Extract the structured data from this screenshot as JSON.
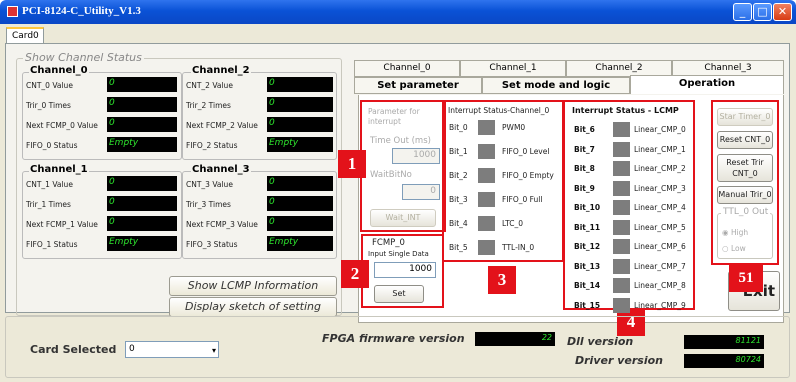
{
  "window": {
    "title": "PCI-8124-C_Utility_V1.3",
    "tab": "Card0"
  },
  "show_channel_status": {
    "title": "Show Channel Status",
    "channels": [
      {
        "name": "Channel_0",
        "rows": [
          {
            "label": "CNT_0 Value",
            "value": "0"
          },
          {
            "label": "Trir_0 Times",
            "value": "0"
          },
          {
            "label": "Next FCMP_0 Value",
            "value": "0"
          },
          {
            "label": "FIFO_0 Status",
            "value": "Empty"
          }
        ]
      },
      {
        "name": "Channel_2",
        "rows": [
          {
            "label": "CNT_2 Value",
            "value": "0"
          },
          {
            "label": "Trir_2 Times",
            "value": "0"
          },
          {
            "label": "Next FCMP_2 Value",
            "value": "0"
          },
          {
            "label": "FIFO_2 Status",
            "value": "Empty"
          }
        ]
      },
      {
        "name": "Channel_1",
        "rows": [
          {
            "label": "CNT_1 Value",
            "value": "0"
          },
          {
            "label": "Trir_1 Times",
            "value": "0"
          },
          {
            "label": "Next FCMP_1 Value",
            "value": "0"
          },
          {
            "label": "FIFO_1 Status",
            "value": "Empty"
          }
        ]
      },
      {
        "name": "Channel_3",
        "rows": [
          {
            "label": "CNT_3 Value",
            "value": "0"
          },
          {
            "label": "Trir_3 Times",
            "value": "0"
          },
          {
            "label": "Next FCMP_3 Value",
            "value": "0"
          },
          {
            "label": "FIFO_3 Status",
            "value": "Empty"
          }
        ]
      }
    ],
    "show_lcmp_label": "Show LCMP Information",
    "display_sketch_label": "Display sketch of setting"
  },
  "tabs_top": [
    "Channel_0",
    "Channel_1",
    "Channel_2",
    "Channel_3"
  ],
  "tabs_bottom": [
    "Set parameter",
    "Set mode and logic",
    "Operation"
  ],
  "param": {
    "title": "Parameter for interrupt",
    "timeout_label": "Time Out (ms)",
    "timeout_value": "1000",
    "waitbit_label": "WaitBitNo",
    "waitbit_value": "0",
    "wait_int_label": "Wait_INT"
  },
  "fcmp": {
    "title": "FCMP_0",
    "input_label": "Input Single Data",
    "input_value": "1000",
    "set_label": "Set"
  },
  "int_status": {
    "title": "Interrupt Status-Channel_0",
    "bits": [
      {
        "bit": "Bit_0",
        "name": "PWM0"
      },
      {
        "bit": "Bit_1",
        "name": "FIFO_0 Level"
      },
      {
        "bit": "Bit_2",
        "name": "FIFO_0 Empty"
      },
      {
        "bit": "Bit_3",
        "name": "FIFO_0 Full"
      },
      {
        "bit": "Bit_4",
        "name": "LTC_0"
      },
      {
        "bit": "Bit_5",
        "name": "TTL-IN_0"
      }
    ]
  },
  "lcmp_status": {
    "title": "Interrupt Status - LCMP",
    "bits": [
      {
        "bit": "Bit_6",
        "name": "Linear_CMP_0"
      },
      {
        "bit": "Bit_7",
        "name": "Linear_CMP_1"
      },
      {
        "bit": "Bit_8",
        "name": "Linear_CMP_2"
      },
      {
        "bit": "Bit_9",
        "name": "Linear_CMP_3"
      },
      {
        "bit": "Bit_10",
        "name": "Linear_CMP_4"
      },
      {
        "bit": "Bit_11",
        "name": "Linear_CMP_5"
      },
      {
        "bit": "Bit_12",
        "name": "Linear_CMP_6"
      },
      {
        "bit": "Bit_13",
        "name": "Linear_CMP_7"
      },
      {
        "bit": "Bit_14",
        "name": "Linear_CMP_8"
      },
      {
        "bit": "Bit_15",
        "name": "Linear_CMP_9"
      }
    ]
  },
  "operation": {
    "star_timer_label": "Star Timer_0",
    "reset_cnt_label": "Reset CNT_0",
    "reset_trir_label": "Reset Trir CNT_0",
    "manual_trir_label": "Manual Trir_0",
    "ttl_title": "TTL_0 Out",
    "ttl_high": "High",
    "ttl_low": "Low",
    "exit_label": "Exit"
  },
  "badges": [
    "1",
    "2",
    "3",
    "4",
    "51"
  ],
  "bottom": {
    "card_selected_label": "Card Selected",
    "card_selected_value": "0",
    "fpga_label": "FPGA firmware version",
    "fpga_value": "22",
    "dll_label": "Dll version",
    "dll_value": "81121",
    "driver_label": "Driver version",
    "driver_value": "80724"
  }
}
